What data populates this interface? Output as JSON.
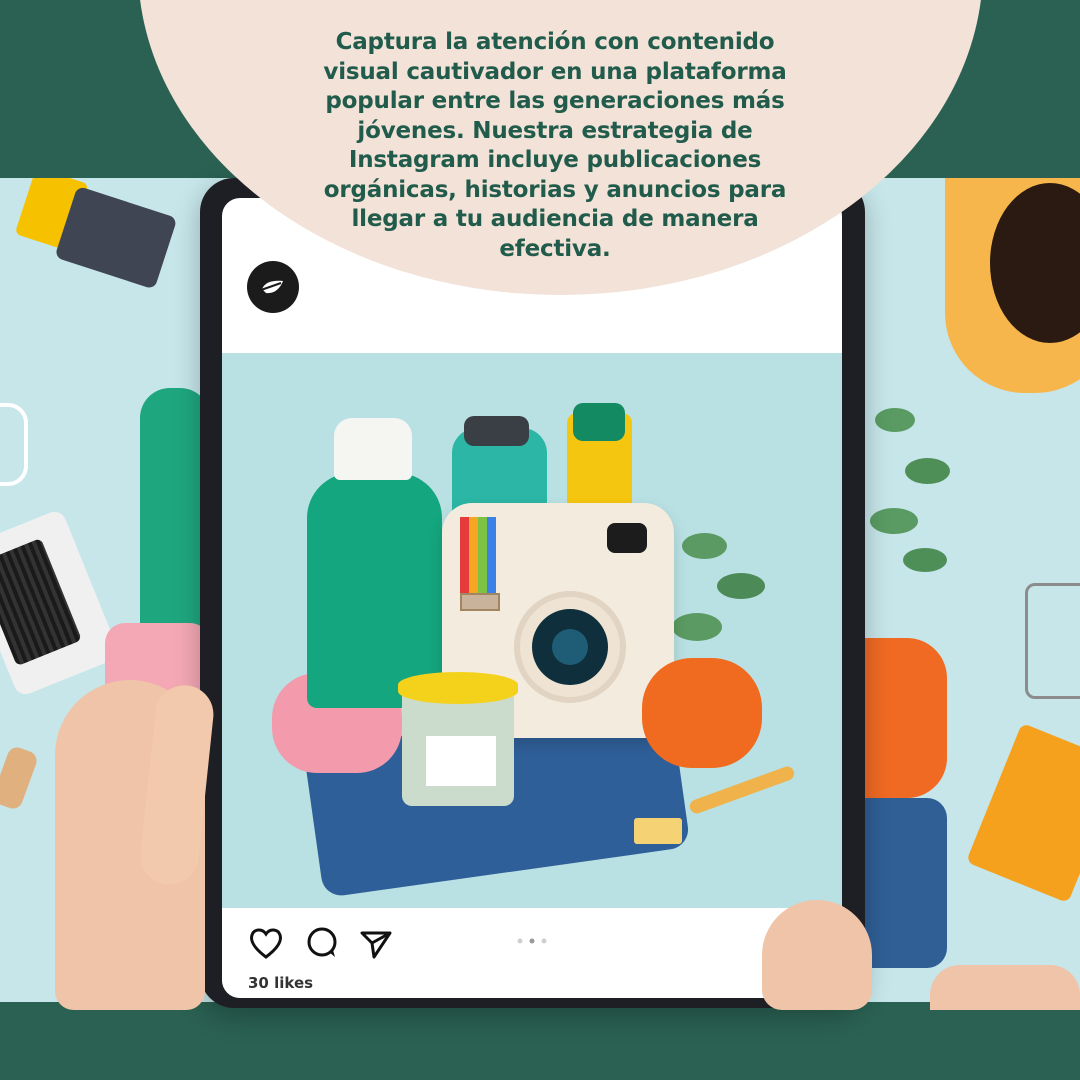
{
  "headline": "Captura la atención con contenido visual cautivador en una plataforma popular entre las generaciones más jóvenes. Nuestra estrategia de Instagram incluye publicaciones orgánicas, historias y anuncios para llegar a tu audiencia de manera efectiva.",
  "post": {
    "likes": "30 likes",
    "carousel_pages": 3,
    "active_page": 2
  },
  "icons": {
    "like": "heart-icon",
    "comment": "comment-icon",
    "share": "send-icon",
    "avatar": "leaf-logo-icon"
  },
  "colors": {
    "brand_green": "#2a6152",
    "headline_text": "#215b4b",
    "headline_bg": "#f2e2d7",
    "photo_bg": "#c6e6ea"
  }
}
